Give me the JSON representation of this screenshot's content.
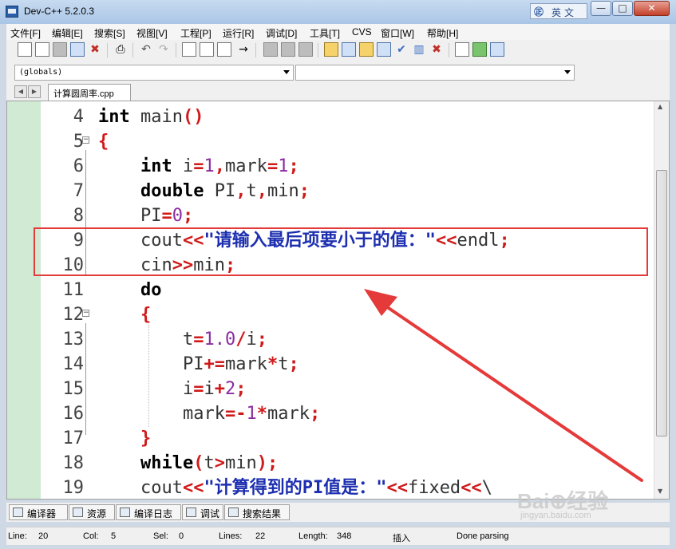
{
  "window": {
    "title": "Dev-C++ 5.2.0.3",
    "ime_glyph": "㊣",
    "ime_label": "英文"
  },
  "menu": [
    "文件[F]",
    "编辑[E]",
    "搜索[S]",
    "视图[V]",
    "工程[P]",
    "运行[R]",
    "调试[D]",
    "工具[T]",
    "CVS",
    "窗口[W]",
    "帮助[H]"
  ],
  "combos": {
    "scope": "(globals)",
    "member": ""
  },
  "tabs": {
    "file": "计算圆周率.cpp"
  },
  "code": {
    "lines": [
      {
        "num": "4",
        "fold": "",
        "tokens": [
          {
            "t": "int",
            "c": "kw"
          },
          {
            "t": " main",
            "c": ""
          },
          {
            "t": "()",
            "c": "op"
          }
        ]
      },
      {
        "num": "5",
        "fold": "⊟",
        "tokens": [
          {
            "t": "{",
            "c": "op"
          }
        ]
      },
      {
        "num": "6",
        "fold": "",
        "tokens": [
          {
            "t": "    ",
            "c": ""
          },
          {
            "t": "int",
            "c": "kw"
          },
          {
            "t": " i",
            "c": ""
          },
          {
            "t": "=",
            "c": "op"
          },
          {
            "t": "1",
            "c": "num"
          },
          {
            "t": ",",
            "c": "op"
          },
          {
            "t": "mark",
            "c": ""
          },
          {
            "t": "=",
            "c": "op"
          },
          {
            "t": "1",
            "c": "num"
          },
          {
            "t": ";",
            "c": "op"
          }
        ]
      },
      {
        "num": "7",
        "fold": "",
        "tokens": [
          {
            "t": "    ",
            "c": ""
          },
          {
            "t": "double",
            "c": "kw"
          },
          {
            "t": " PI",
            "c": ""
          },
          {
            "t": ",",
            "c": "op"
          },
          {
            "t": "t",
            "c": ""
          },
          {
            "t": ",",
            "c": "op"
          },
          {
            "t": "min",
            "c": ""
          },
          {
            "t": ";",
            "c": "op"
          }
        ]
      },
      {
        "num": "8",
        "fold": "",
        "tokens": [
          {
            "t": "    PI",
            "c": ""
          },
          {
            "t": "=",
            "c": "op"
          },
          {
            "t": "0",
            "c": "num"
          },
          {
            "t": ";",
            "c": "op"
          }
        ]
      },
      {
        "num": "9",
        "fold": "",
        "tokens": [
          {
            "t": "    cout",
            "c": ""
          },
          {
            "t": "<<",
            "c": "op"
          },
          {
            "t": "\"请输入最后项要小于的值：\"",
            "c": "str"
          },
          {
            "t": "<<",
            "c": "op"
          },
          {
            "t": "endl",
            "c": ""
          },
          {
            "t": ";",
            "c": "op"
          }
        ]
      },
      {
        "num": "10",
        "fold": "",
        "tokens": [
          {
            "t": "    cin",
            "c": ""
          },
          {
            "t": ">>",
            "c": "op"
          },
          {
            "t": "min",
            "c": ""
          },
          {
            "t": ";",
            "c": "op"
          }
        ]
      },
      {
        "num": "11",
        "fold": "",
        "tokens": [
          {
            "t": "    ",
            "c": ""
          },
          {
            "t": "do",
            "c": "kw"
          }
        ]
      },
      {
        "num": "12",
        "fold": "⊟",
        "tokens": [
          {
            "t": "    ",
            "c": ""
          },
          {
            "t": "{",
            "c": "op"
          }
        ]
      },
      {
        "num": "13",
        "fold": "",
        "tokens": [
          {
            "t": "        t",
            "c": ""
          },
          {
            "t": "=",
            "c": "op"
          },
          {
            "t": "1.0",
            "c": "num"
          },
          {
            "t": "/",
            "c": "op"
          },
          {
            "t": "i",
            "c": ""
          },
          {
            "t": ";",
            "c": "op"
          }
        ]
      },
      {
        "num": "14",
        "fold": "",
        "tokens": [
          {
            "t": "        PI",
            "c": ""
          },
          {
            "t": "+=",
            "c": "op"
          },
          {
            "t": "mark",
            "c": ""
          },
          {
            "t": "*",
            "c": "op"
          },
          {
            "t": "t",
            "c": ""
          },
          {
            "t": ";",
            "c": "op"
          }
        ]
      },
      {
        "num": "15",
        "fold": "",
        "tokens": [
          {
            "t": "        i",
            "c": ""
          },
          {
            "t": "=",
            "c": "op"
          },
          {
            "t": "i",
            "c": ""
          },
          {
            "t": "+",
            "c": "op"
          },
          {
            "t": "2",
            "c": "num"
          },
          {
            "t": ";",
            "c": "op"
          }
        ]
      },
      {
        "num": "16",
        "fold": "",
        "tokens": [
          {
            "t": "        mark",
            "c": ""
          },
          {
            "t": "=-",
            "c": "op"
          },
          {
            "t": "1",
            "c": "num"
          },
          {
            "t": "*",
            "c": "op"
          },
          {
            "t": "mark",
            "c": ""
          },
          {
            "t": ";",
            "c": "op"
          }
        ]
      },
      {
        "num": "17",
        "fold": "",
        "tokens": [
          {
            "t": "    ",
            "c": ""
          },
          {
            "t": "}",
            "c": "op"
          }
        ]
      },
      {
        "num": "18",
        "fold": "",
        "tokens": [
          {
            "t": "    ",
            "c": ""
          },
          {
            "t": "while",
            "c": "kw"
          },
          {
            "t": "(",
            "c": "op"
          },
          {
            "t": "t",
            "c": ""
          },
          {
            "t": ">",
            "c": "op"
          },
          {
            "t": "min",
            "c": ""
          },
          {
            "t": ");",
            "c": "op"
          }
        ]
      },
      {
        "num": "19",
        "fold": "",
        "tokens": [
          {
            "t": "    cout",
            "c": ""
          },
          {
            "t": "<<",
            "c": "op"
          },
          {
            "t": "\"计算得到的PI值是：\"",
            "c": "str"
          },
          {
            "t": "<<",
            "c": "op"
          },
          {
            "t": "fixed",
            "c": ""
          },
          {
            "t": "<<",
            "c": "op"
          },
          {
            "t": "\\",
            "c": ""
          }
        ]
      }
    ]
  },
  "bottom_tabs": [
    "编译器",
    "资源",
    "编译日志",
    "调试",
    "搜索结果"
  ],
  "status": {
    "line_label": "Line:",
    "line_value": "20",
    "col_label": "Col:",
    "col_value": "5",
    "sel_label": "Sel:",
    "sel_value": "0",
    "lines_label": "Lines:",
    "lines_value": "22",
    "length_label": "Length:",
    "length_value": "348",
    "mode": "插入",
    "message": "Done parsing"
  },
  "watermark": {
    "text": "Bai⊕经验",
    "sub": "jingyan.baidu.com"
  },
  "colors": {
    "highlight_box": "#e53a3a",
    "arrow": "#e53a3a",
    "gutter": "#d0ead3"
  }
}
